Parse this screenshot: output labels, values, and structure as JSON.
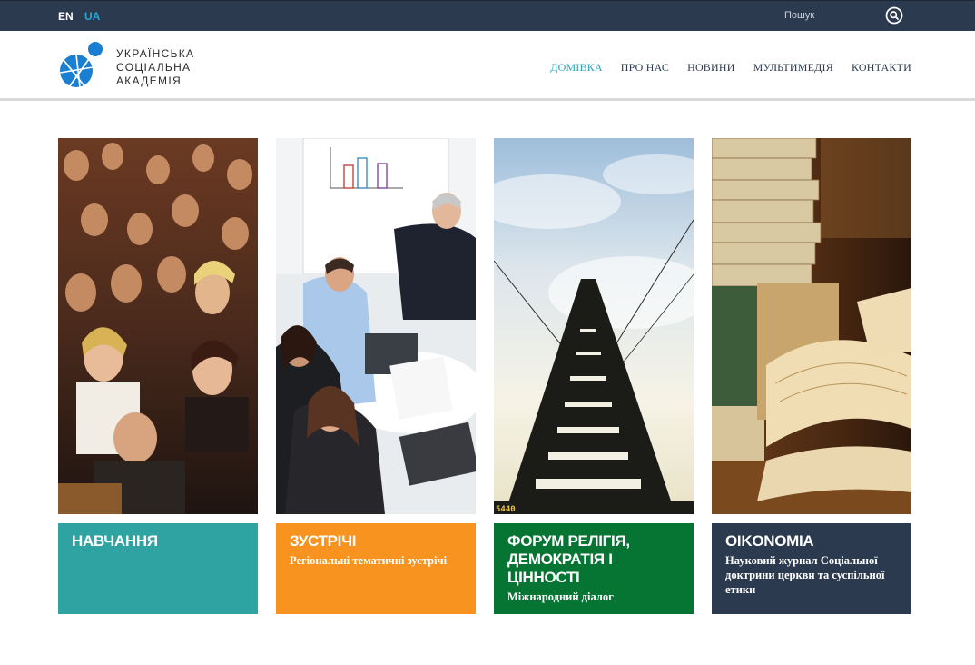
{
  "topbar": {
    "lang_en": "EN",
    "lang_ua": "UA",
    "search_placeholder": "Пошук",
    "search_icon": "search-icon"
  },
  "logo": {
    "line1": "УКРАЇНСЬКА",
    "line2": "СОЦІАЛЬНА",
    "line3": "АКАДЕМІЯ"
  },
  "nav": {
    "items": [
      "ДОМІВКА",
      "ПРО НАС",
      "НОВИНИ",
      "МУЛЬТИМЕДІЯ",
      "КОНТАКТИ"
    ],
    "active": "ДОМІВКА"
  },
  "cards": [
    {
      "title": "НАВЧАННЯ",
      "subtitle": ""
    },
    {
      "title": "ЗУСТРІЧІ",
      "subtitle": "Регіональні тематичні зустрічі"
    },
    {
      "title": "ФОРУМ РЕЛІГІЯ, ДЕМОКРАТІЯ І ЦІННОСТІ",
      "subtitle": "Міжнародний діалог"
    },
    {
      "title": "OIKONOMIA",
      "subtitle": "Науковий журнал Соціальної доктрини церкви та суспільної етики"
    }
  ],
  "colors": {
    "topbar": "#2c3a4f",
    "accent": "#2aa6b8",
    "card1": "#2ea3a2",
    "card2": "#f7931e",
    "card3": "#067534",
    "card4": "#2c3a4f",
    "logo_blue": "#1b7fd1"
  }
}
